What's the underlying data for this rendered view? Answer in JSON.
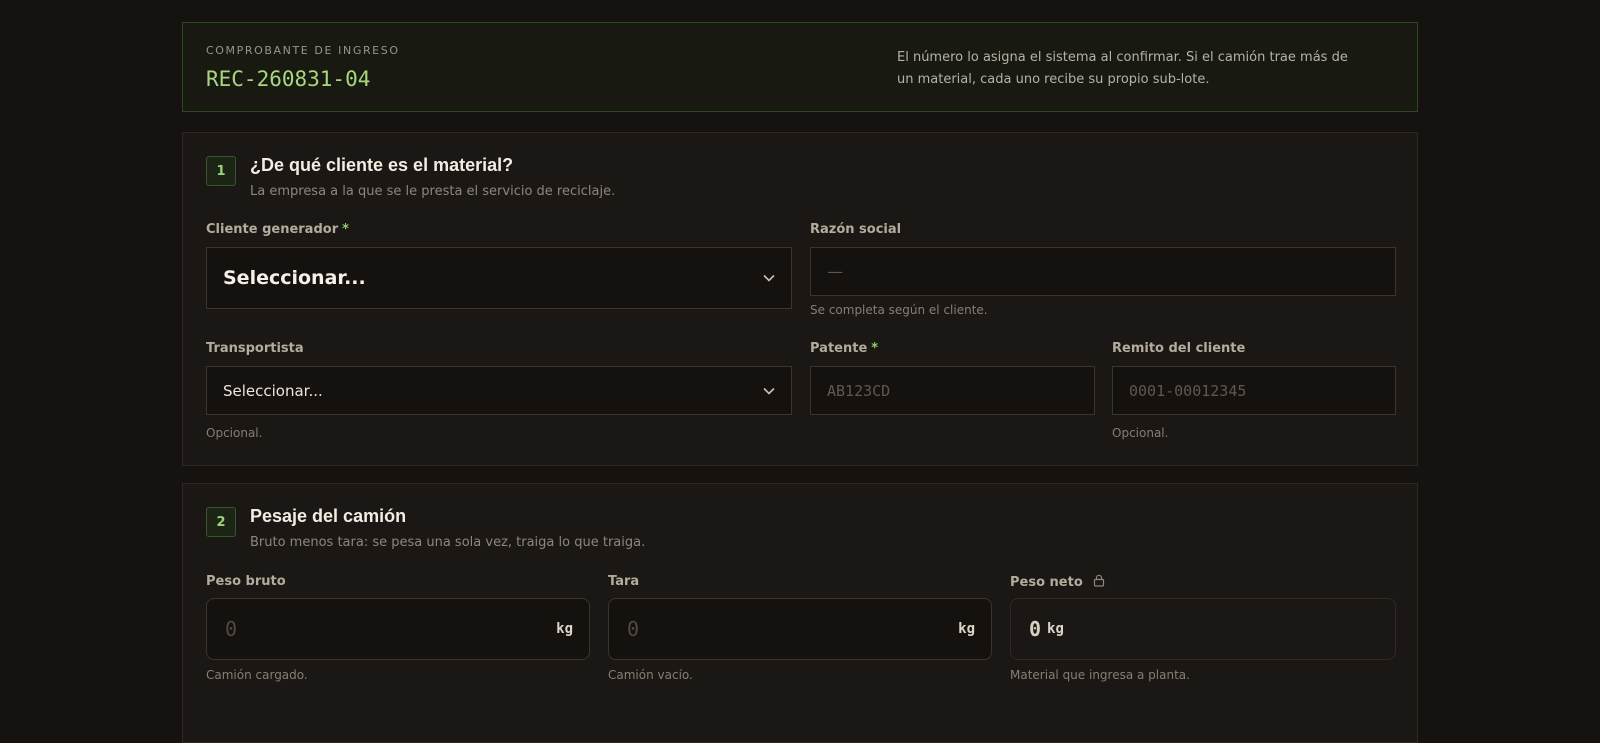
{
  "receipt": {
    "eyebrow": "COMPROBANTE DE INGRESO",
    "code": "REC-260831-04",
    "note": "El número lo asigna el sistema al confirmar. Si el camión trae más de un material, cada uno recibe su propio sub-lote."
  },
  "section1": {
    "step": "1",
    "title": "¿De qué cliente es el material?",
    "subtitle": "La empresa a la que se le presta el servicio de reciclaje.",
    "cliente": {
      "label": "Cliente generador",
      "required": "*",
      "value": "Seleccionar..."
    },
    "razon": {
      "label": "Razón social",
      "value": "—",
      "help": "Se completa según el cliente."
    },
    "transportista": {
      "label": "Transportista",
      "value": "Seleccionar...",
      "help": "Opcional."
    },
    "patente": {
      "label": "Patente",
      "required": "*",
      "placeholder": "AB123CD"
    },
    "remito": {
      "label": "Remito del cliente",
      "placeholder": "0001-00012345",
      "help": "Opcional."
    }
  },
  "section2": {
    "step": "2",
    "title": "Pesaje del camión",
    "subtitle": "Bruto menos tara: se pesa una sola vez, traiga lo que traiga.",
    "bruto": {
      "label": "Peso bruto",
      "placeholder": "0",
      "unit": "kg",
      "help": "Camión cargado."
    },
    "tara": {
      "label": "Tara",
      "placeholder": "0",
      "unit": "kg",
      "help": "Camión vacío."
    },
    "neto": {
      "label": "Peso neto",
      "value": "0",
      "unit": "kg",
      "help": "Material que ingresa a planta.",
      "icon": "lock-icon"
    }
  },
  "colors": {
    "accent": "#a8d77f",
    "background": "#151210",
    "card": "#1a1714"
  }
}
